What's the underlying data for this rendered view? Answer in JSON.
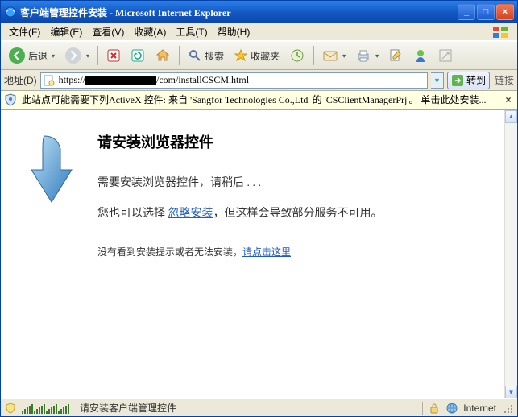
{
  "window": {
    "title": "客户端管理控件安装 - Microsoft Internet Explorer"
  },
  "menu": {
    "file": "文件(F)",
    "edit": "编辑(E)",
    "view": "查看(V)",
    "favorites": "收藏(A)",
    "tools": "工具(T)",
    "help": "帮助(H)"
  },
  "toolbar": {
    "back": "后退",
    "search": "搜索",
    "favorites": "收藏夹"
  },
  "address": {
    "label": "地址(D)",
    "url_prefix": "https://",
    "url_suffix": "/com/installCSCM.html",
    "go": "转到",
    "links": "链接"
  },
  "infobar": {
    "text": "此站点可能需要下列ActiveX 控件: 来自 'Sangfor Technologies Co.,Ltd' 的 'CSClientManagerPrj'。 单击此处安装..."
  },
  "page": {
    "heading": "请安装浏览器控件",
    "line1": "需要安装浏览器控件，请稍后 . . .",
    "line2a": "您也可以选择 ",
    "line2_link": "忽略安装",
    "line2b": "，但这样会导致部分服务不可用。",
    "line3a": "没有看到安装提示或者无法安装，",
    "line3_link": "请点击这里"
  },
  "status": {
    "text": "请安装客户端管理控件",
    "zone": "Internet"
  },
  "colors": {
    "link": "#205bc3",
    "infobar_bg": "#ffffe1"
  }
}
